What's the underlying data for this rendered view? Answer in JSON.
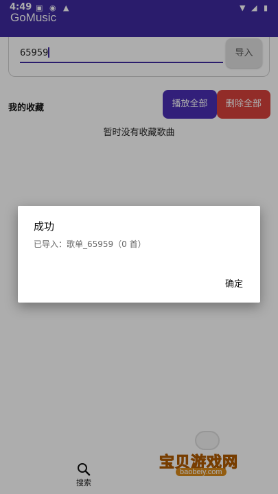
{
  "status_bar": {
    "time": "4:49",
    "icons": [
      "a-icon",
      "record-icon",
      "alert-icon",
      "wifi-icon",
      "signal-icon",
      "battery-icon"
    ]
  },
  "app": {
    "title": "GoMusic"
  },
  "import": {
    "input_value": "65959",
    "button_label": "导入"
  },
  "favorites": {
    "title": "我的收藏",
    "play_all_label": "播放全部",
    "delete_all_label": "删除全部",
    "empty_text": "暂时没有收藏歌曲"
  },
  "bottom_nav": {
    "search_label": "搜索"
  },
  "dialog": {
    "title": "成功",
    "message": "已导入：歌单_65959（0 首）",
    "ok_label": "确定"
  },
  "watermark": {
    "text": "宝贝游戏网",
    "url": "baobeiy.com"
  },
  "colors": {
    "primary": "#3f2aa0",
    "play_button": "#4a2fb4",
    "delete_button": "#d8413b"
  }
}
